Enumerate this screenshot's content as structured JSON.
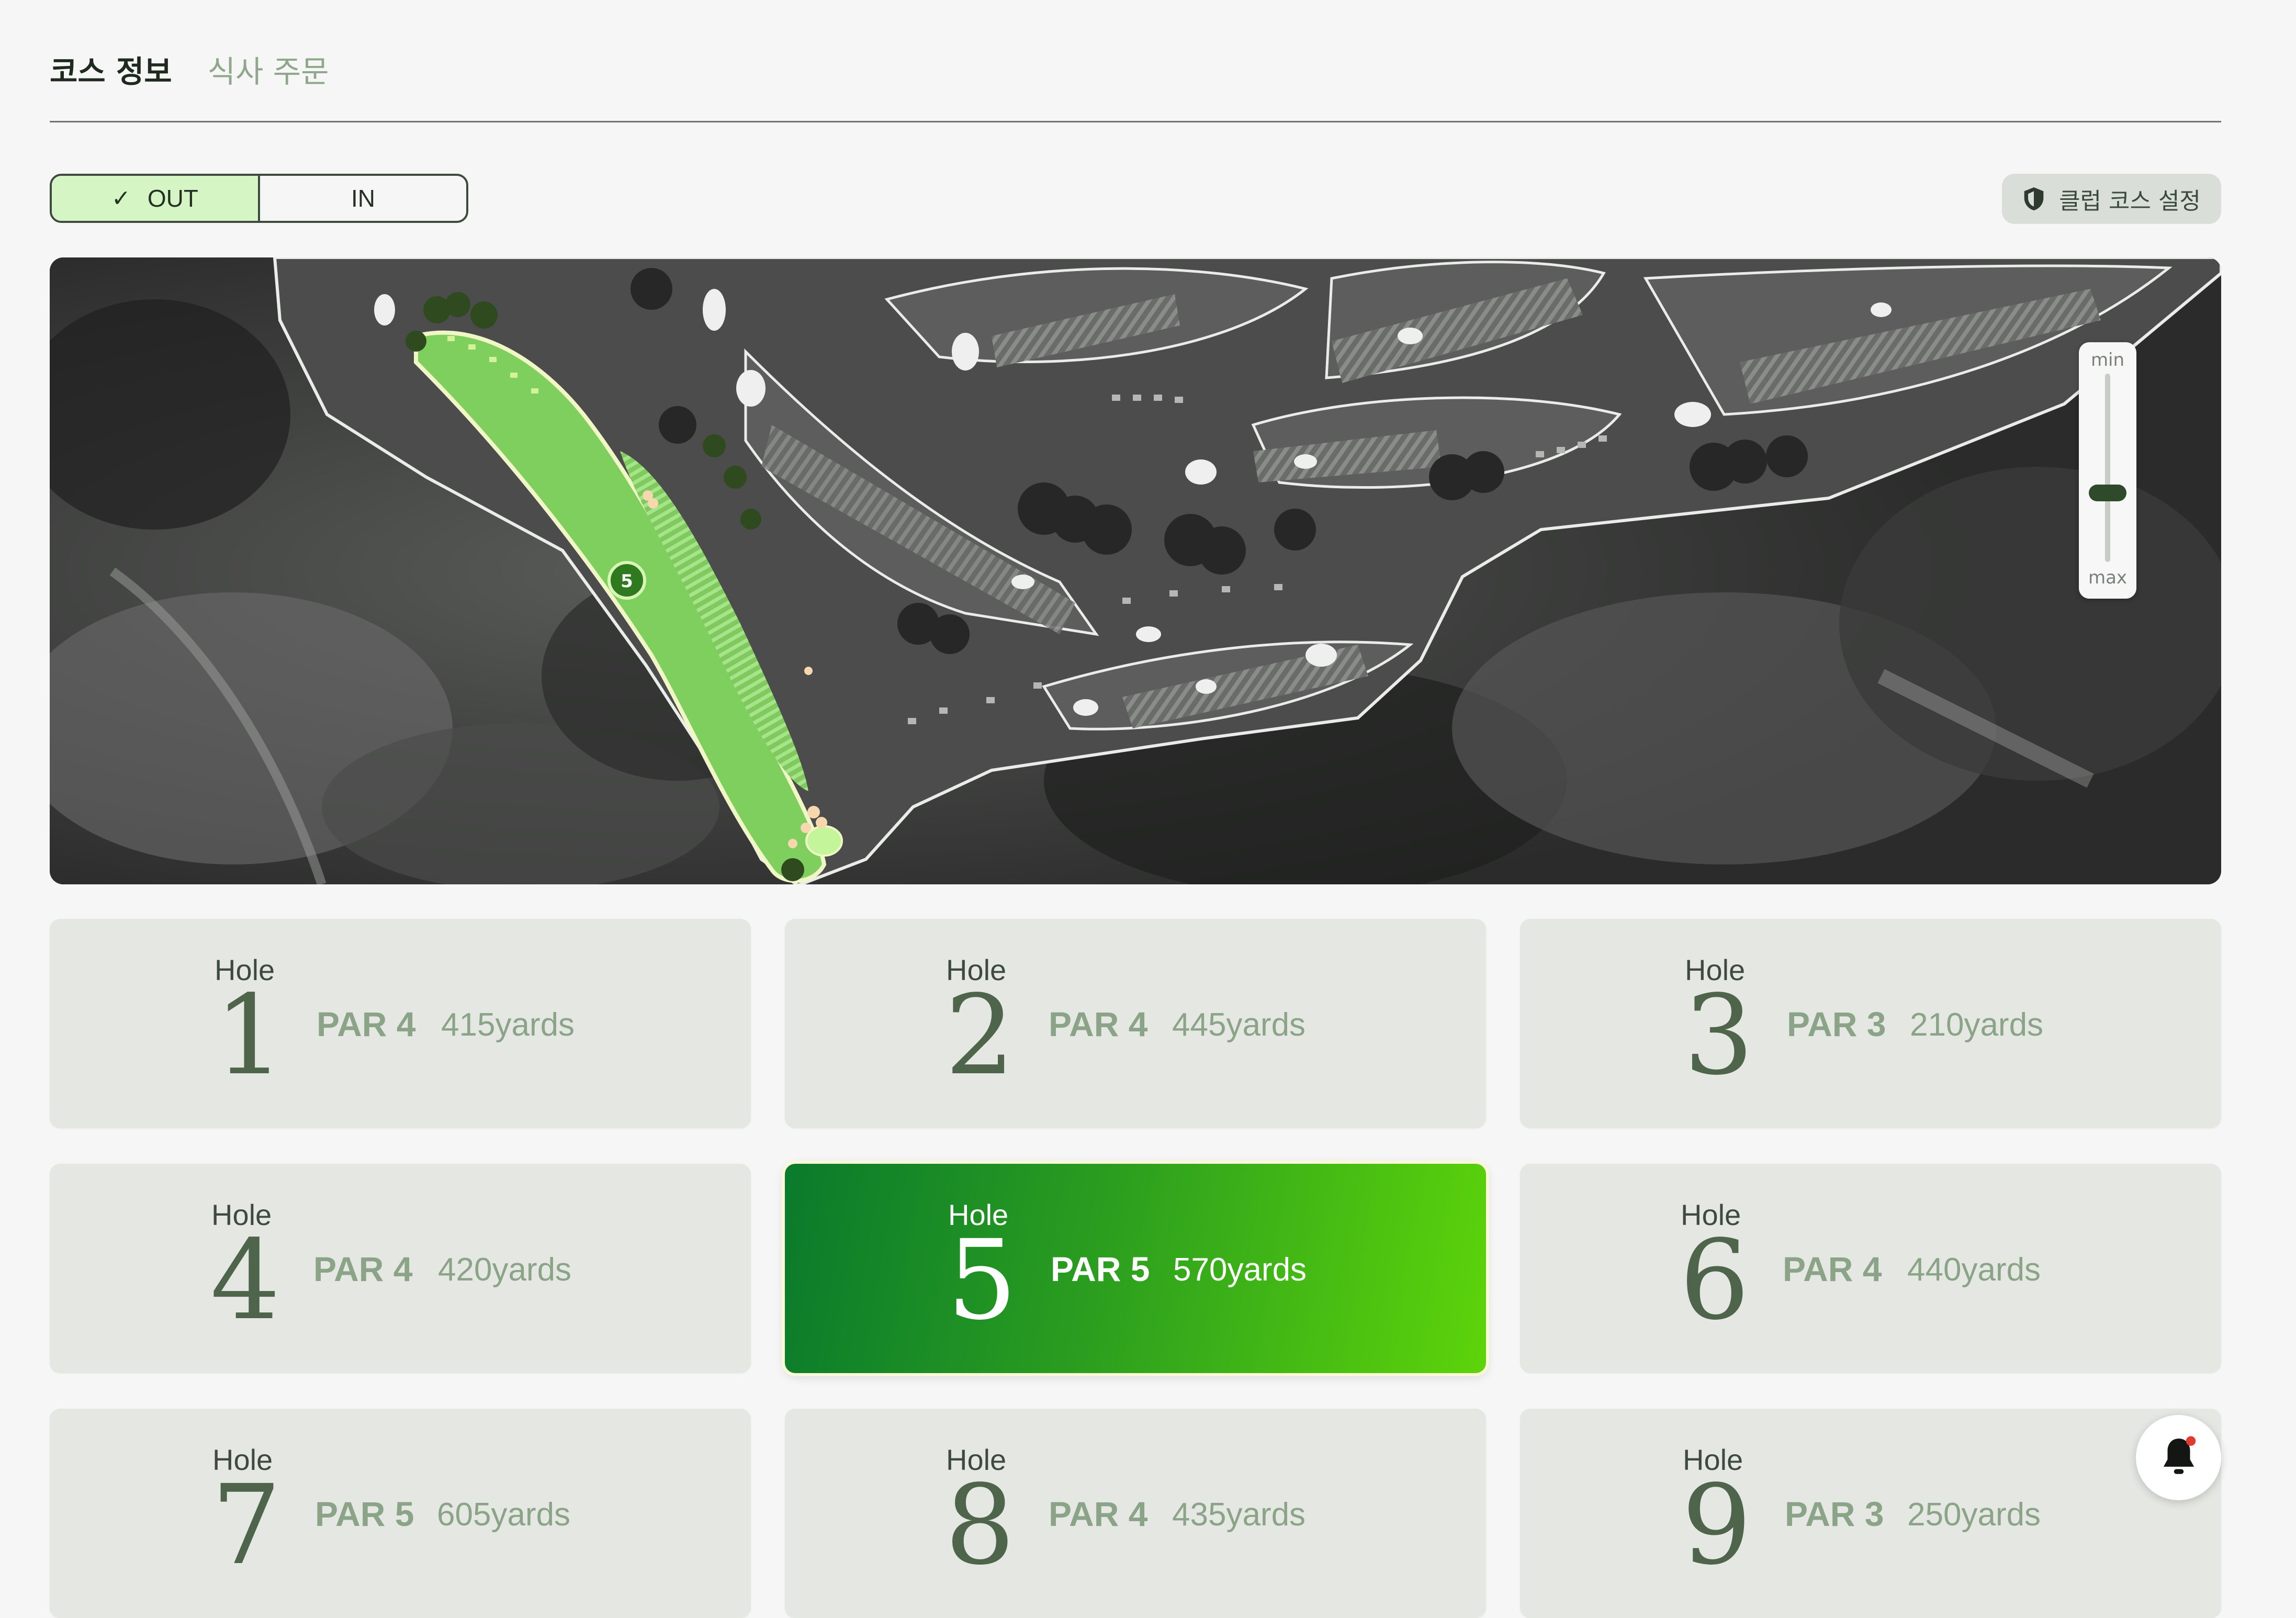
{
  "tabs": [
    {
      "label": "코스 정보",
      "active": true
    },
    {
      "label": "식사 주문",
      "active": false
    }
  ],
  "segment": {
    "out": "OUT",
    "in": "IN",
    "selected": "OUT"
  },
  "club_button": {
    "label": "클럽 코스 설정",
    "icon": "shield-icon"
  },
  "map": {
    "hole_marker": "5",
    "zoom_min": "min",
    "zoom_max": "max",
    "zoom_level": 0.68
  },
  "hole_word": "Hole",
  "holes": [
    {
      "number": "1",
      "par": "PAR 4",
      "yards": "415yards"
    },
    {
      "number": "2",
      "par": "PAR 4",
      "yards": "445yards"
    },
    {
      "number": "3",
      "par": "PAR 3",
      "yards": "210yards"
    },
    {
      "number": "4",
      "par": "PAR 4",
      "yards": "420yards"
    },
    {
      "number": "5",
      "par": "PAR 5",
      "yards": "570yards"
    },
    {
      "number": "6",
      "par": "PAR 4",
      "yards": "440yards"
    },
    {
      "number": "7",
      "par": "PAR 5",
      "yards": "605yards"
    },
    {
      "number": "8",
      "par": "PAR 4",
      "yards": "435yards"
    },
    {
      "number": "9",
      "par": "PAR 3",
      "yards": "250yards"
    }
  ],
  "selected_hole": "5",
  "notification": {
    "icon": "bell-icon",
    "has_unread": true
  },
  "colors": {
    "accent": "#2b9e1f",
    "accent_light": "#d6f5c4",
    "muted_green": "#8ba488",
    "alert": "#e23a2e"
  }
}
